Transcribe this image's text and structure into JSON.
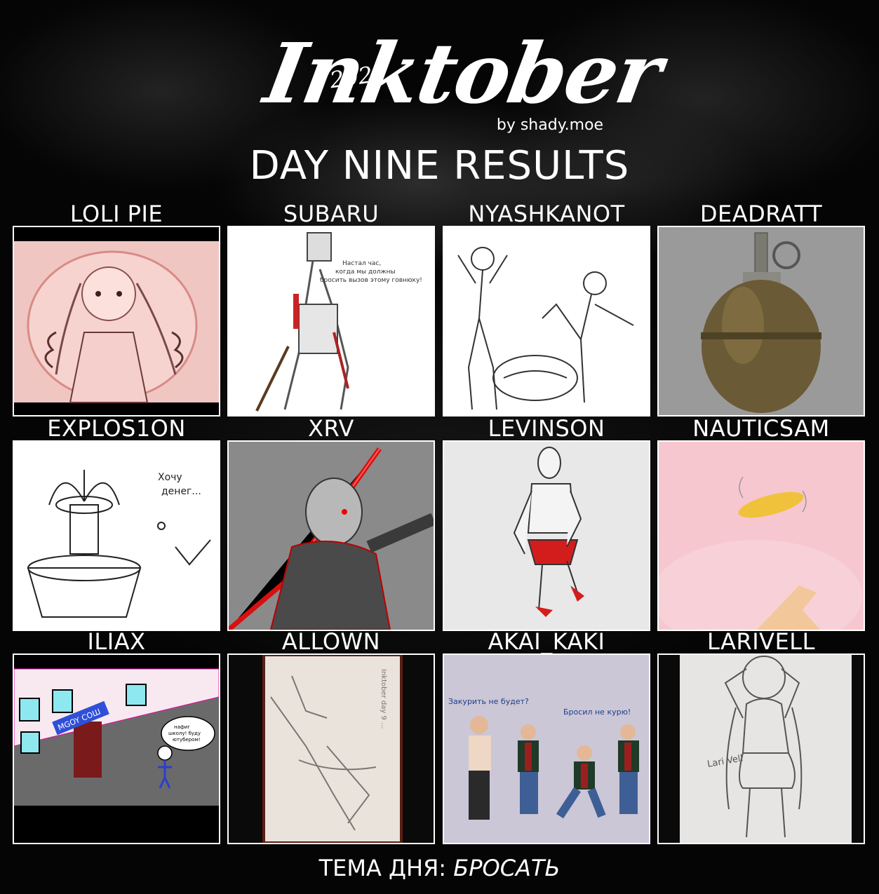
{
  "header": {
    "year": "2020",
    "brand": "Inktober",
    "byline": "by shady.moe",
    "title": "DAY NINE RESULTS"
  },
  "entries": [
    {
      "name": "LOLI PIE",
      "art": "pink-anime-girl-sketch"
    },
    {
      "name": "SUBARU",
      "art": "character-with-mug-sketch",
      "caption": [
        "Настал час,",
        "когда мы должны",
        "бросить вызов этому говнюку!"
      ]
    },
    {
      "name": "NYASHKANOT",
      "art": "two-figures-throwing-sketch"
    },
    {
      "name": "DEADRATT",
      "art": "grenade-render"
    },
    {
      "name": "EXPLOS1ON",
      "art": "fountain-coin-doodle",
      "caption": [
        "Хочу",
        "денег..."
      ]
    },
    {
      "name": "XRV",
      "art": "red-spear-warrior"
    },
    {
      "name": "LEVINSON",
      "art": "mannequin-figure-red"
    },
    {
      "name": "NAUTICSAM",
      "art": "pink-coin-toss"
    },
    {
      "name": "ILIAX",
      "art": "school-street-doodle",
      "caption": [
        "нафиг",
        "школу! буду",
        "ютубером!"
      ],
      "sign": "MGOY COШ"
    },
    {
      "name": "ALLOWN",
      "art": "pencil-sketch-photo",
      "caption": [
        "Inktober day 9 ..."
      ]
    },
    {
      "name": "AKAI_KAKI",
      "art": "smoking-men-comic",
      "caption": [
        "Закурить не будет?",
        "Бросил не курю!"
      ]
    },
    {
      "name": "LARIVELL",
      "art": "girl-ball-pencil-sketch",
      "sign": "Lari Vell"
    }
  ],
  "footer": {
    "theme_label": "ТЕМА ДНЯ:",
    "theme_value": "БРОСАТЬ"
  },
  "colors": {
    "background": "#000000",
    "text": "#ffffff",
    "frame": "#ffffff"
  }
}
